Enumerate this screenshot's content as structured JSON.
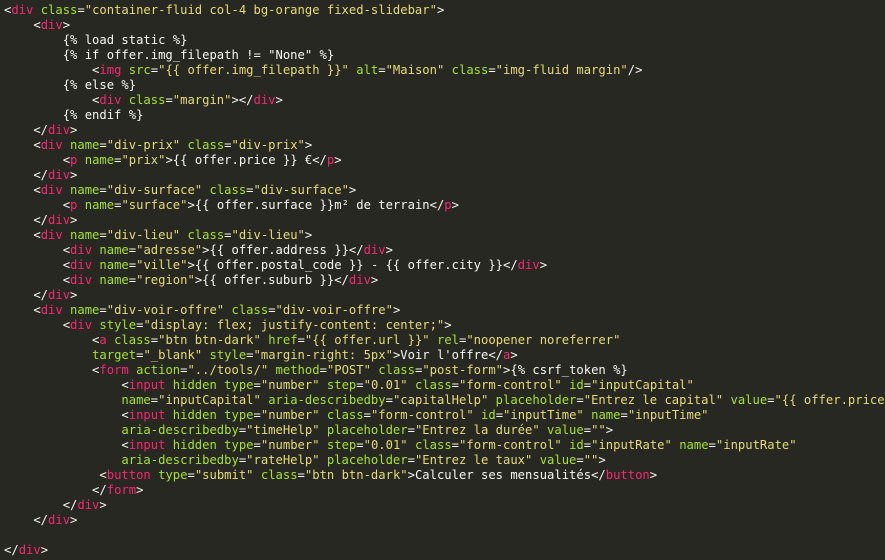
{
  "editor": {
    "language": "html-django",
    "colors": {
      "background": "#272822",
      "tag": "#f92672",
      "attribute": "#a6e22e",
      "string": "#e6db74",
      "text": "#f8f8f2"
    },
    "lines": [
      [
        [
          "p",
          "<"
        ],
        [
          "tag",
          "div"
        ],
        [
          "p",
          " "
        ],
        [
          "attr",
          "class"
        ],
        [
          "p",
          "="
        ],
        [
          "str",
          "\"container-fluid col-4 bg-orange fixed-slidebar\""
        ],
        [
          "p",
          ">"
        ]
      ],
      [
        [
          "p",
          "    <"
        ],
        [
          "tag",
          "div"
        ],
        [
          "p",
          ">"
        ]
      ],
      [
        [
          "t",
          "        {% load static %}"
        ]
      ],
      [
        [
          "t",
          "        {% if offer.img_filepath != \"None\" %}"
        ]
      ],
      [
        [
          "p",
          "            <"
        ],
        [
          "tag",
          "img"
        ],
        [
          "p",
          " "
        ],
        [
          "attr",
          "src"
        ],
        [
          "p",
          "="
        ],
        [
          "str",
          "\"{{ offer.img_filepath }}\""
        ],
        [
          "p",
          " "
        ],
        [
          "attr",
          "alt"
        ],
        [
          "p",
          "="
        ],
        [
          "str",
          "\"Maison\""
        ],
        [
          "p",
          " "
        ],
        [
          "attr",
          "class"
        ],
        [
          "p",
          "="
        ],
        [
          "str",
          "\"img-fluid margin\""
        ],
        [
          "p",
          "/>"
        ]
      ],
      [
        [
          "t",
          "        {% else %}"
        ]
      ],
      [
        [
          "p",
          "            <"
        ],
        [
          "tag",
          "div"
        ],
        [
          "p",
          " "
        ],
        [
          "attr",
          "class"
        ],
        [
          "p",
          "="
        ],
        [
          "str",
          "\"margin\""
        ],
        [
          "p",
          "></"
        ],
        [
          "tag",
          "div"
        ],
        [
          "p",
          ">"
        ]
      ],
      [
        [
          "t",
          "        {% endif %}"
        ]
      ],
      [
        [
          "p",
          "    </"
        ],
        [
          "tag",
          "div"
        ],
        [
          "p",
          ">"
        ]
      ],
      [
        [
          "p",
          "    <"
        ],
        [
          "tag",
          "div"
        ],
        [
          "p",
          " "
        ],
        [
          "attr",
          "name"
        ],
        [
          "p",
          "="
        ],
        [
          "str",
          "\"div-prix\""
        ],
        [
          "p",
          " "
        ],
        [
          "attr",
          "class"
        ],
        [
          "p",
          "="
        ],
        [
          "str",
          "\"div-prix\""
        ],
        [
          "p",
          ">"
        ]
      ],
      [
        [
          "p",
          "        <"
        ],
        [
          "tag",
          "p"
        ],
        [
          "p",
          " "
        ],
        [
          "attr",
          "name"
        ],
        [
          "p",
          "="
        ],
        [
          "str",
          "\"prix\""
        ],
        [
          "p",
          ">{{ offer.price }} €</"
        ],
        [
          "tag",
          "p"
        ],
        [
          "p",
          ">"
        ]
      ],
      [
        [
          "p",
          "    </"
        ],
        [
          "tag",
          "div"
        ],
        [
          "p",
          ">"
        ]
      ],
      [
        [
          "p",
          "    <"
        ],
        [
          "tag",
          "div"
        ],
        [
          "p",
          " "
        ],
        [
          "attr",
          "name"
        ],
        [
          "p",
          "="
        ],
        [
          "str",
          "\"div-surface\""
        ],
        [
          "p",
          " "
        ],
        [
          "attr",
          "class"
        ],
        [
          "p",
          "="
        ],
        [
          "str",
          "\"div-surface\""
        ],
        [
          "p",
          ">"
        ]
      ],
      [
        [
          "p",
          "        <"
        ],
        [
          "tag",
          "p"
        ],
        [
          "p",
          " "
        ],
        [
          "attr",
          "name"
        ],
        [
          "p",
          "="
        ],
        [
          "str",
          "\"surface\""
        ],
        [
          "p",
          ">{{ offer.surface }}m² de terrain</"
        ],
        [
          "tag",
          "p"
        ],
        [
          "p",
          ">"
        ]
      ],
      [
        [
          "p",
          "    </"
        ],
        [
          "tag",
          "div"
        ],
        [
          "p",
          ">"
        ]
      ],
      [
        [
          "p",
          "    <"
        ],
        [
          "tag",
          "div"
        ],
        [
          "p",
          " "
        ],
        [
          "attr",
          "name"
        ],
        [
          "p",
          "="
        ],
        [
          "str",
          "\"div-lieu\""
        ],
        [
          "p",
          " "
        ],
        [
          "attr",
          "class"
        ],
        [
          "p",
          "="
        ],
        [
          "str",
          "\"div-lieu\""
        ],
        [
          "p",
          ">"
        ]
      ],
      [
        [
          "p",
          "        <"
        ],
        [
          "tag",
          "div"
        ],
        [
          "p",
          " "
        ],
        [
          "attr",
          "name"
        ],
        [
          "p",
          "="
        ],
        [
          "str",
          "\"adresse\""
        ],
        [
          "p",
          ">{{ offer.address }}</"
        ],
        [
          "tag",
          "div"
        ],
        [
          "p",
          ">"
        ]
      ],
      [
        [
          "p",
          "        <"
        ],
        [
          "tag",
          "div"
        ],
        [
          "p",
          " "
        ],
        [
          "attr",
          "name"
        ],
        [
          "p",
          "="
        ],
        [
          "str",
          "\"ville\""
        ],
        [
          "p",
          ">{{ offer.postal_code }} - {{ offer.city }}</"
        ],
        [
          "tag",
          "div"
        ],
        [
          "p",
          ">"
        ]
      ],
      [
        [
          "p",
          "        <"
        ],
        [
          "tag",
          "div"
        ],
        [
          "p",
          " "
        ],
        [
          "attr",
          "name"
        ],
        [
          "p",
          "="
        ],
        [
          "str",
          "\"region\""
        ],
        [
          "p",
          ">{{ offer.suburb }}</"
        ],
        [
          "tag",
          "div"
        ],
        [
          "p",
          ">"
        ]
      ],
      [
        [
          "p",
          "    </"
        ],
        [
          "tag",
          "div"
        ],
        [
          "p",
          ">"
        ]
      ],
      [
        [
          "p",
          "    <"
        ],
        [
          "tag",
          "div"
        ],
        [
          "p",
          " "
        ],
        [
          "attr",
          "name"
        ],
        [
          "p",
          "="
        ],
        [
          "str",
          "\"div-voir-offre\""
        ],
        [
          "p",
          " "
        ],
        [
          "attr",
          "class"
        ],
        [
          "p",
          "="
        ],
        [
          "str",
          "\"div-voir-offre\""
        ],
        [
          "p",
          ">"
        ]
      ],
      [
        [
          "p",
          "        <"
        ],
        [
          "tag",
          "div"
        ],
        [
          "p",
          " "
        ],
        [
          "attr",
          "style"
        ],
        [
          "p",
          "="
        ],
        [
          "str",
          "\"display: flex; justify-content: center;\""
        ],
        [
          "p",
          ">"
        ]
      ],
      [
        [
          "p",
          "            <"
        ],
        [
          "tag",
          "a"
        ],
        [
          "p",
          " "
        ],
        [
          "attr",
          "class"
        ],
        [
          "p",
          "="
        ],
        [
          "str",
          "\"btn btn-dark\""
        ],
        [
          "p",
          " "
        ],
        [
          "attr",
          "href"
        ],
        [
          "p",
          "="
        ],
        [
          "str",
          "\"{{ offer.url }}\""
        ],
        [
          "p",
          " "
        ],
        [
          "attr",
          "rel"
        ],
        [
          "p",
          "="
        ],
        [
          "str",
          "\"noopener noreferrer\""
        ]
      ],
      [
        [
          "p",
          "            "
        ],
        [
          "attr",
          "target"
        ],
        [
          "p",
          "="
        ],
        [
          "str",
          "\"_blank\""
        ],
        [
          "p",
          " "
        ],
        [
          "attr",
          "style"
        ],
        [
          "p",
          "="
        ],
        [
          "str",
          "\"margin-right: 5px\""
        ],
        [
          "p",
          ">Voir l'offre</"
        ],
        [
          "tag",
          "a"
        ],
        [
          "p",
          ">"
        ]
      ],
      [
        [
          "p",
          "            <"
        ],
        [
          "tag",
          "form"
        ],
        [
          "p",
          " "
        ],
        [
          "attr",
          "action"
        ],
        [
          "p",
          "="
        ],
        [
          "str",
          "\"../tools/\""
        ],
        [
          "p",
          " "
        ],
        [
          "attr",
          "method"
        ],
        [
          "p",
          "="
        ],
        [
          "str",
          "\"POST\""
        ],
        [
          "p",
          " "
        ],
        [
          "attr",
          "class"
        ],
        [
          "p",
          "="
        ],
        [
          "str",
          "\"post-form\""
        ],
        [
          "p",
          ">{% csrf_token %}"
        ]
      ],
      [
        [
          "p",
          "                <"
        ],
        [
          "tag",
          "input"
        ],
        [
          "p",
          " "
        ],
        [
          "attr",
          "hidden"
        ],
        [
          "p",
          " "
        ],
        [
          "attr",
          "type"
        ],
        [
          "p",
          "="
        ],
        [
          "str",
          "\"number\""
        ],
        [
          "p",
          " "
        ],
        [
          "attr",
          "step"
        ],
        [
          "p",
          "="
        ],
        [
          "str",
          "\"0.01\""
        ],
        [
          "p",
          " "
        ],
        [
          "attr",
          "class"
        ],
        [
          "p",
          "="
        ],
        [
          "str",
          "\"form-control\""
        ],
        [
          "p",
          " "
        ],
        [
          "attr",
          "id"
        ],
        [
          "p",
          "="
        ],
        [
          "str",
          "\"inputCapital\""
        ]
      ],
      [
        [
          "p",
          "                "
        ],
        [
          "attr",
          "name"
        ],
        [
          "p",
          "="
        ],
        [
          "str",
          "\"inputCapital\""
        ],
        [
          "p",
          " "
        ],
        [
          "attr",
          "aria-describedby"
        ],
        [
          "p",
          "="
        ],
        [
          "str",
          "\"capitalHelp\""
        ],
        [
          "p",
          " "
        ],
        [
          "attr",
          "placeholder"
        ],
        [
          "p",
          "="
        ],
        [
          "str",
          "\"Entrez le capital\""
        ],
        [
          "p",
          " "
        ],
        [
          "attr",
          "value"
        ],
        [
          "p",
          "="
        ],
        [
          "str",
          "\"{{ offer.price }}\""
        ],
        [
          "p",
          ">"
        ]
      ],
      [
        [
          "p",
          "                <"
        ],
        [
          "tag",
          "input"
        ],
        [
          "p",
          " "
        ],
        [
          "attr",
          "hidden"
        ],
        [
          "p",
          " "
        ],
        [
          "attr",
          "type"
        ],
        [
          "p",
          "="
        ],
        [
          "str",
          "\"number\""
        ],
        [
          "p",
          " "
        ],
        [
          "attr",
          "class"
        ],
        [
          "p",
          "="
        ],
        [
          "str",
          "\"form-control\""
        ],
        [
          "p",
          " "
        ],
        [
          "attr",
          "id"
        ],
        [
          "p",
          "="
        ],
        [
          "str",
          "\"inputTime\""
        ],
        [
          "p",
          " "
        ],
        [
          "attr",
          "name"
        ],
        [
          "p",
          "="
        ],
        [
          "str",
          "\"inputTime\""
        ]
      ],
      [
        [
          "p",
          "                "
        ],
        [
          "attr",
          "aria-describedby"
        ],
        [
          "p",
          "="
        ],
        [
          "str",
          "\"timeHelp\""
        ],
        [
          "p",
          " "
        ],
        [
          "attr",
          "placeholder"
        ],
        [
          "p",
          "="
        ],
        [
          "str",
          "\"Entrez la durée\""
        ],
        [
          "p",
          " "
        ],
        [
          "attr",
          "value"
        ],
        [
          "p",
          "="
        ],
        [
          "str",
          "\"\""
        ],
        [
          "p",
          ">"
        ]
      ],
      [
        [
          "p",
          "                <"
        ],
        [
          "tag",
          "input"
        ],
        [
          "p",
          " "
        ],
        [
          "attr",
          "hidden"
        ],
        [
          "p",
          " "
        ],
        [
          "attr",
          "type"
        ],
        [
          "p",
          "="
        ],
        [
          "str",
          "\"number\""
        ],
        [
          "p",
          " "
        ],
        [
          "attr",
          "step"
        ],
        [
          "p",
          "="
        ],
        [
          "str",
          "\"0.01\""
        ],
        [
          "p",
          " "
        ],
        [
          "attr",
          "class"
        ],
        [
          "p",
          "="
        ],
        [
          "str",
          "\"form-control\""
        ],
        [
          "p",
          " "
        ],
        [
          "attr",
          "id"
        ],
        [
          "p",
          "="
        ],
        [
          "str",
          "\"inputRate\""
        ],
        [
          "p",
          " "
        ],
        [
          "attr",
          "name"
        ],
        [
          "p",
          "="
        ],
        [
          "str",
          "\"inputRate\""
        ]
      ],
      [
        [
          "p",
          "                "
        ],
        [
          "attr",
          "aria-describedby"
        ],
        [
          "p",
          "="
        ],
        [
          "str",
          "\"rateHelp\""
        ],
        [
          "p",
          " "
        ],
        [
          "attr",
          "placeholder"
        ],
        [
          "p",
          "="
        ],
        [
          "str",
          "\"Entrez le taux\""
        ],
        [
          "p",
          " "
        ],
        [
          "attr",
          "value"
        ],
        [
          "p",
          "="
        ],
        [
          "str",
          "\"\""
        ],
        [
          "p",
          ">"
        ]
      ],
      [
        [
          "p",
          "             <"
        ],
        [
          "tag",
          "button"
        ],
        [
          "p",
          " "
        ],
        [
          "attr",
          "type"
        ],
        [
          "p",
          "="
        ],
        [
          "str",
          "\"submit\""
        ],
        [
          "p",
          " "
        ],
        [
          "attr",
          "class"
        ],
        [
          "p",
          "="
        ],
        [
          "str",
          "\"btn btn-dark\""
        ],
        [
          "p",
          ">Calculer ses mensualités</"
        ],
        [
          "tag",
          "button"
        ],
        [
          "p",
          ">"
        ]
      ],
      [
        [
          "p",
          "            </"
        ],
        [
          "tag",
          "form"
        ],
        [
          "p",
          ">"
        ]
      ],
      [
        [
          "p",
          "        </"
        ],
        [
          "tag",
          "div"
        ],
        [
          "p",
          ">"
        ]
      ],
      [
        [
          "p",
          "    </"
        ],
        [
          "tag",
          "div"
        ],
        [
          "p",
          ">"
        ]
      ],
      [],
      [
        [
          "p",
          "</"
        ],
        [
          "tag",
          "div"
        ],
        [
          "p",
          ">"
        ]
      ]
    ]
  }
}
